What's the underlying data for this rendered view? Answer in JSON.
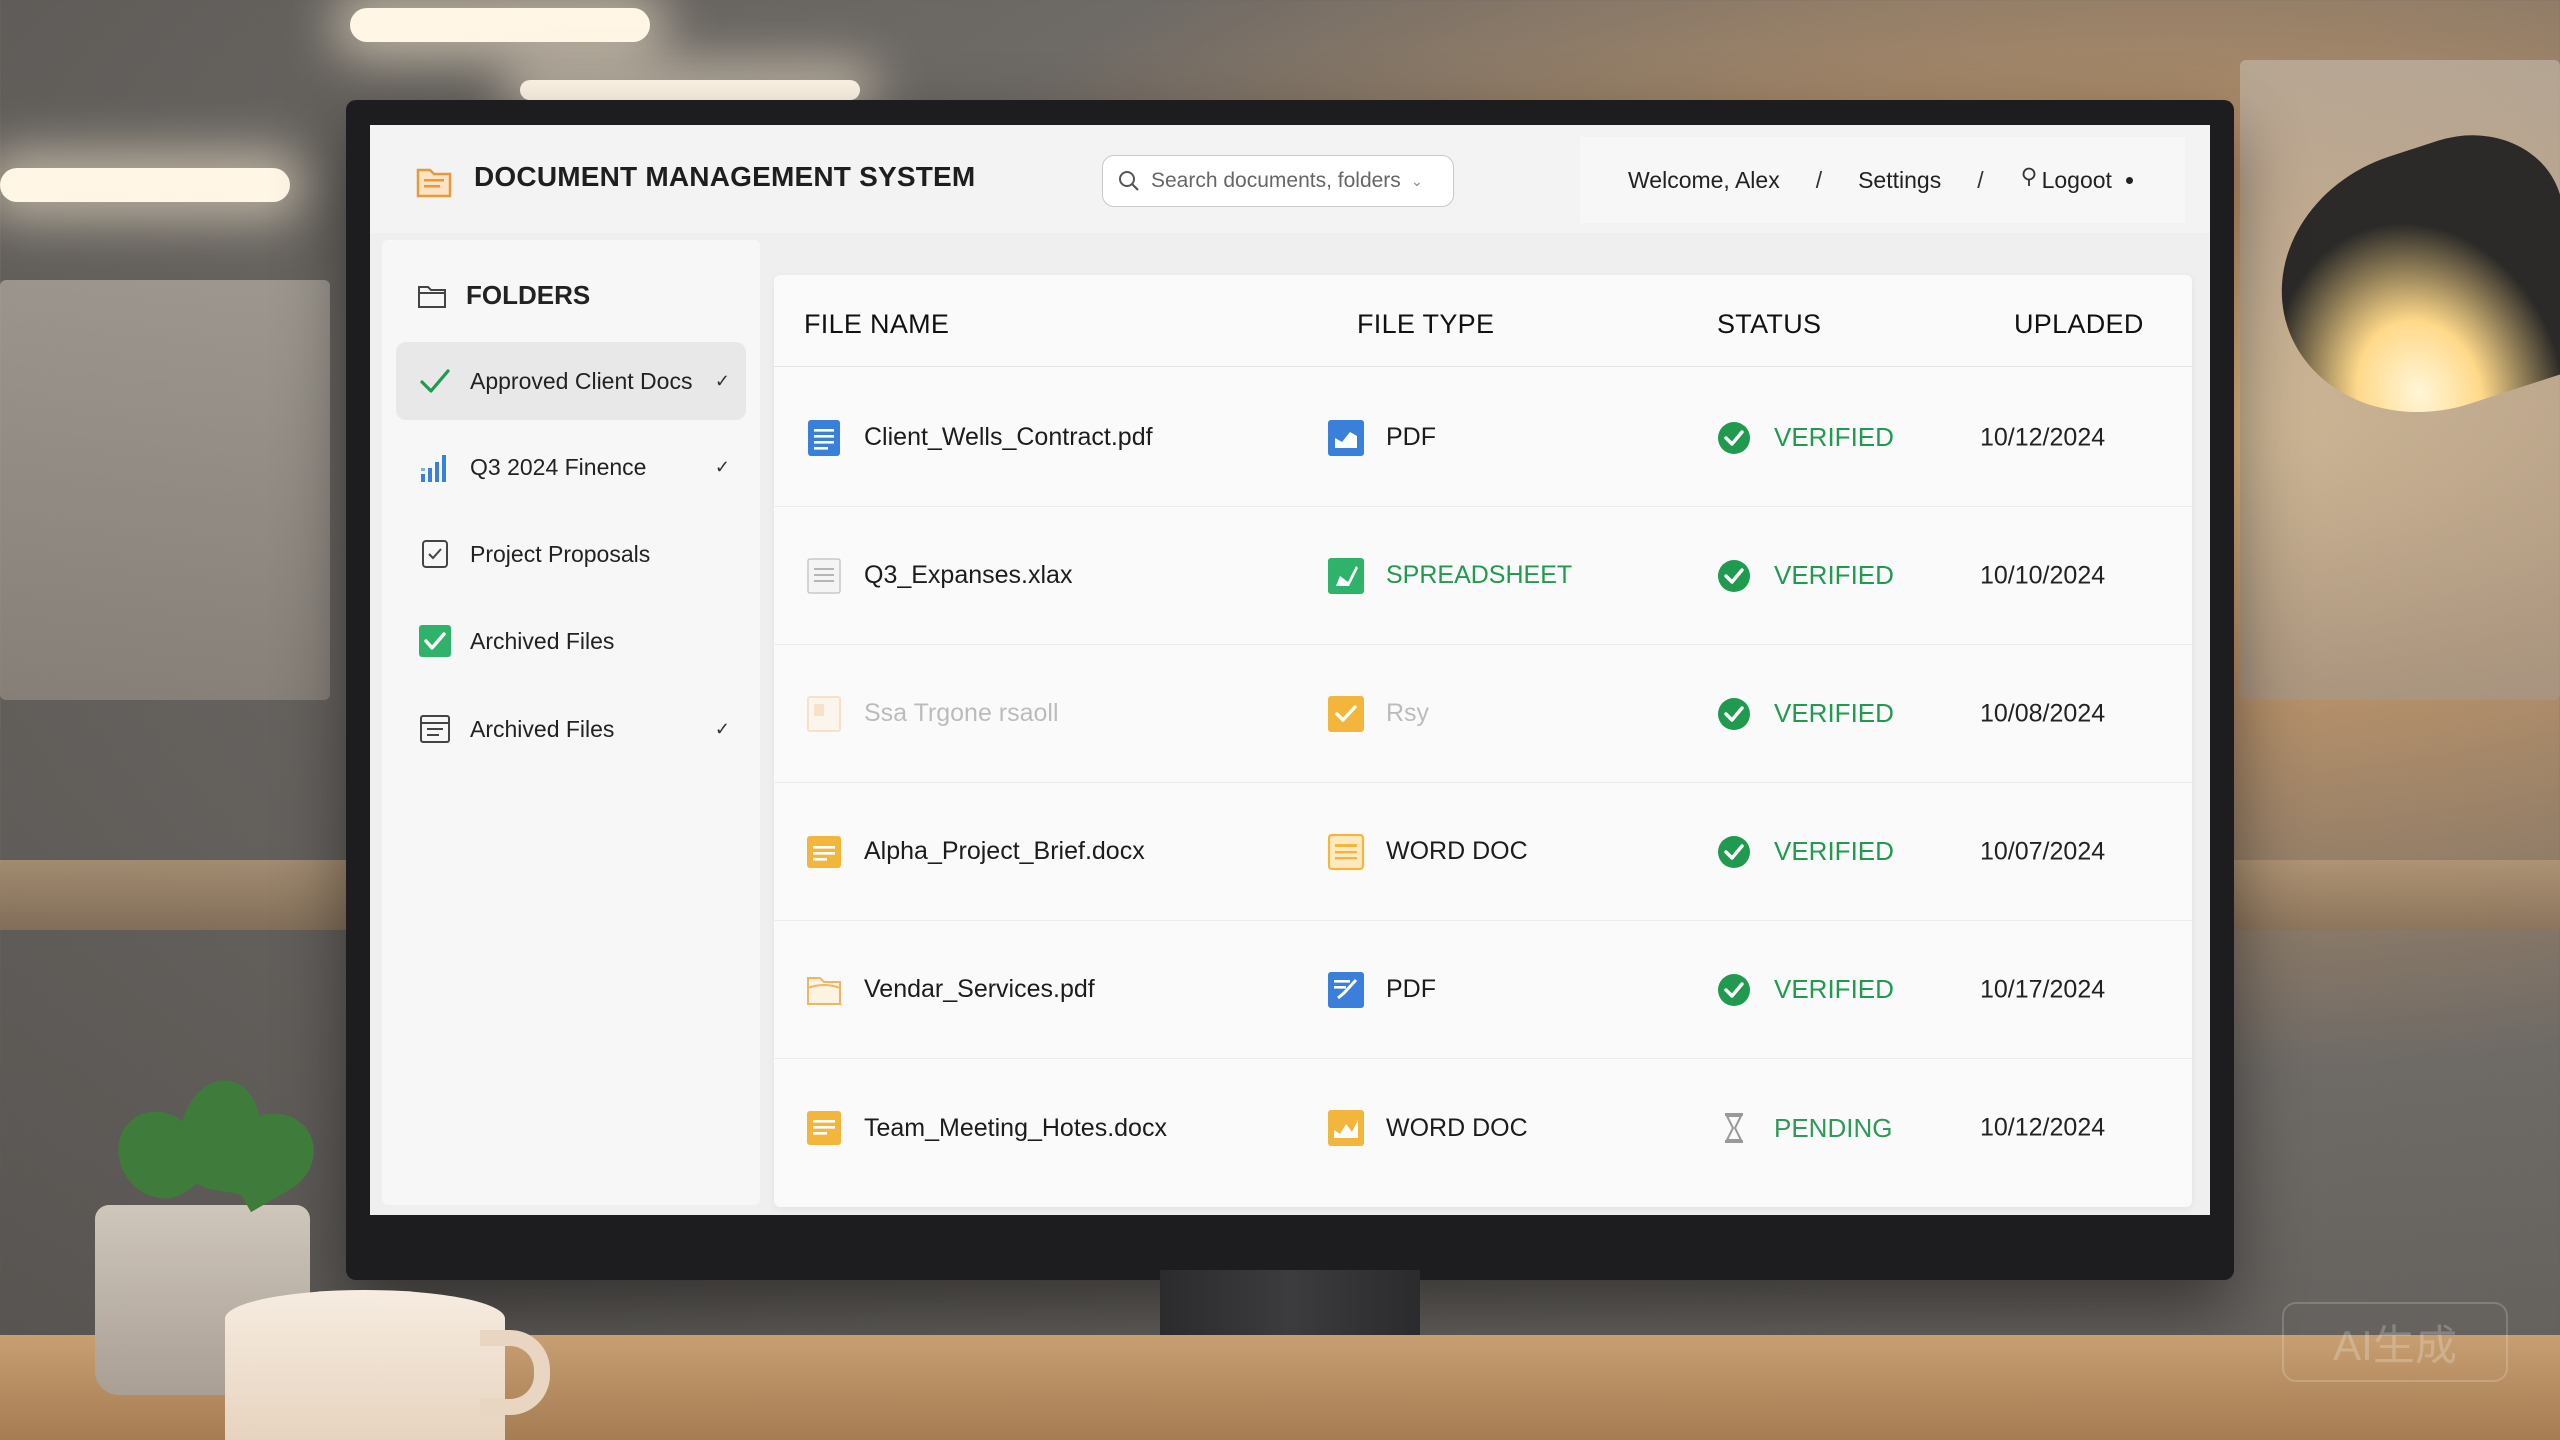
{
  "app": {
    "title": "DOCUMENT MANAGEMENT SYSTEM"
  },
  "search": {
    "placeholder": "Search documents, folders"
  },
  "user_nav": {
    "welcome": "Welcome, Alex",
    "separator": "/",
    "settings": "Settings",
    "logout": "Logoot"
  },
  "sidebar": {
    "heading": "FOLDERS",
    "items": [
      {
        "label": "Approved Client Docs",
        "icon": "checkmark-icon",
        "active": true,
        "chevron": true
      },
      {
        "label": "Q3 2024 Finence",
        "icon": "bar-chart-icon",
        "active": false,
        "chevron": true
      },
      {
        "label": "Project Proposals",
        "icon": "checklist-icon",
        "active": false,
        "chevron": false
      },
      {
        "label": "Archived Files",
        "icon": "checkbox-checked-icon",
        "active": false,
        "chevron": false
      },
      {
        "label": "Archived Files",
        "icon": "archive-list-icon",
        "active": false,
        "chevron": true
      }
    ]
  },
  "table": {
    "headers": {
      "name": "FILE NAME",
      "type": "FILE TYPE",
      "status": "STATUS",
      "uploaded": "UPLADED"
    },
    "rows": [
      {
        "name": "Client_Wells_Contract.pdf",
        "type": "PDF",
        "status": "VERIFIED",
        "date": "10/12/2024"
      },
      {
        "name": "Q3_Expanses.xlax",
        "type": "SPREADSHEET",
        "status": "VERIFIED",
        "date": "10/10/2024"
      },
      {
        "name": "Ssa Trgone rsaoll",
        "type": "Rsy",
        "status": "VERIFIED",
        "date": "10/08/2024"
      },
      {
        "name": "Alpha_Project_Brief.docx",
        "type": "WORD DOC",
        "status": "VERIFIED",
        "date": "10/07/2024"
      },
      {
        "name": "Vendar_Services.pdf",
        "type": "PDF",
        "status": "VERIFIED",
        "date": "10/17/2024"
      },
      {
        "name": "Team_Meeting_Hotes.docx",
        "type": "WORD DOC",
        "status": "PENDING",
        "date": "10/12/2024"
      }
    ]
  },
  "watermark": "AI生成",
  "colors": {
    "verified": "#1f9a4f",
    "doc_blue": "#3a7fd9",
    "doc_yellow": "#f2b63c",
    "sheet_green": "#2fb36a"
  }
}
